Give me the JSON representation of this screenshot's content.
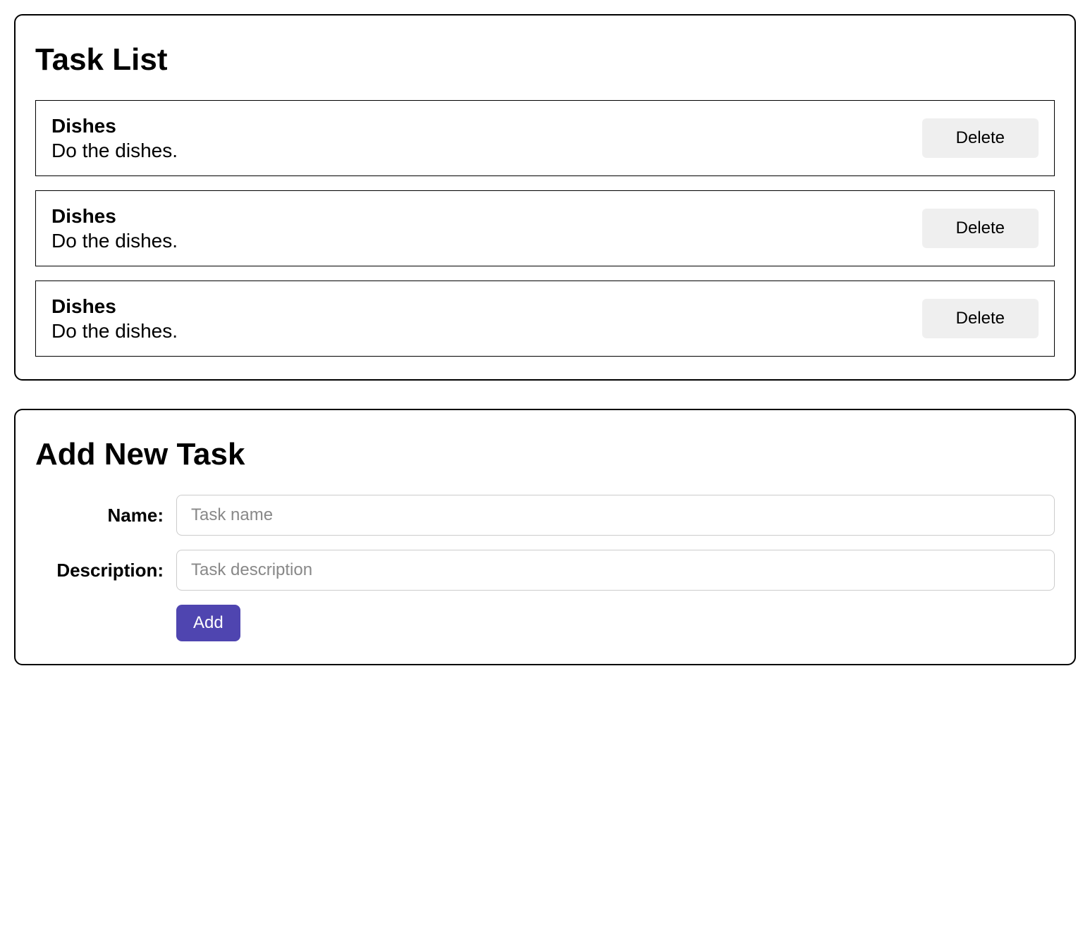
{
  "taskList": {
    "title": "Task List",
    "tasks": [
      {
        "name": "Dishes",
        "description": "Do the dishes."
      },
      {
        "name": "Dishes",
        "description": "Do the dishes."
      },
      {
        "name": "Dishes",
        "description": "Do the dishes."
      }
    ],
    "deleteLabel": "Delete"
  },
  "addTask": {
    "title": "Add New Task",
    "nameLabel": "Name:",
    "namePlaceholder": "Task name",
    "descriptionLabel": "Description:",
    "descriptionPlaceholder": "Task description",
    "addLabel": "Add"
  },
  "colors": {
    "accent": "#4f45b0",
    "buttonGray": "#efefef"
  }
}
